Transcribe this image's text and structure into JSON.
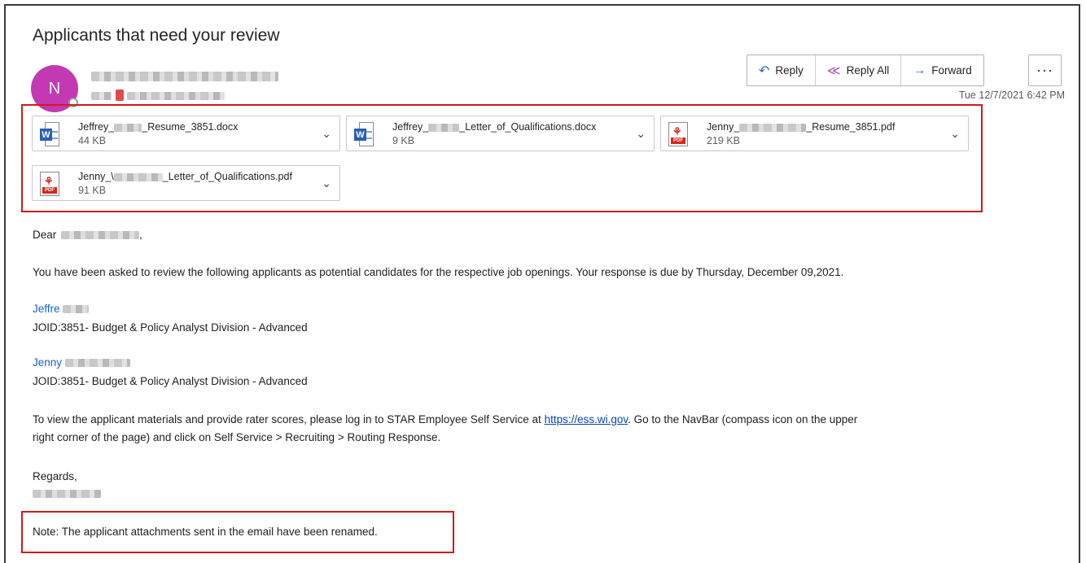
{
  "email": {
    "subject": "Applicants that need your review",
    "avatar_initial": "N",
    "date": "Tue 12/7/2021 6:42 PM"
  },
  "actions": {
    "reply": "Reply",
    "reply_all": "Reply All",
    "forward": "Forward",
    "more": "···"
  },
  "attachments": [
    {
      "name_prefix": "Jeffrey_",
      "name_suffix": "_Resume_3851.docx",
      "size": "44 KB",
      "type": "word"
    },
    {
      "name_prefix": "Jeffrey_",
      "name_suffix": "_Letter_of_Qualifications.docx",
      "size": "9 KB",
      "type": "word"
    },
    {
      "name_prefix": "Jenny_",
      "name_suffix": "_Resume_3851.pdf",
      "size": "219 KB",
      "type": "pdf"
    },
    {
      "name_prefix": "Jenny_\\",
      "name_suffix": "_Letter_of_Qualifications.pdf",
      "size": "91 KB",
      "type": "pdf"
    }
  ],
  "body": {
    "greeting": "Dear",
    "intro": "You have been asked to review the following applicants as potential candidates for the respective job openings. Your response is due by Thursday, December 09,2021.",
    "applicant1_name": "Jeffre",
    "applicant1_job": "JOID:3851- Budget & Policy Analyst Division - Advanced",
    "applicant2_name": "Jenny",
    "applicant2_job": "JOID:3851- Budget & Policy Analyst Division - Advanced",
    "instructions_before": "To view the applicant materials and provide rater scores, please log in to STAR Employee Self Service at ",
    "instructions_link": "https://ess.wi.gov",
    "instructions_after": ". Go to the NavBar (compass icon on the upper",
    "instructions_line2": "right corner of the page) and click on Self Service > Recruiting > Routing Response.",
    "regards": "Regards,",
    "note": "Note: The applicant attachments sent in the email have been renamed."
  }
}
